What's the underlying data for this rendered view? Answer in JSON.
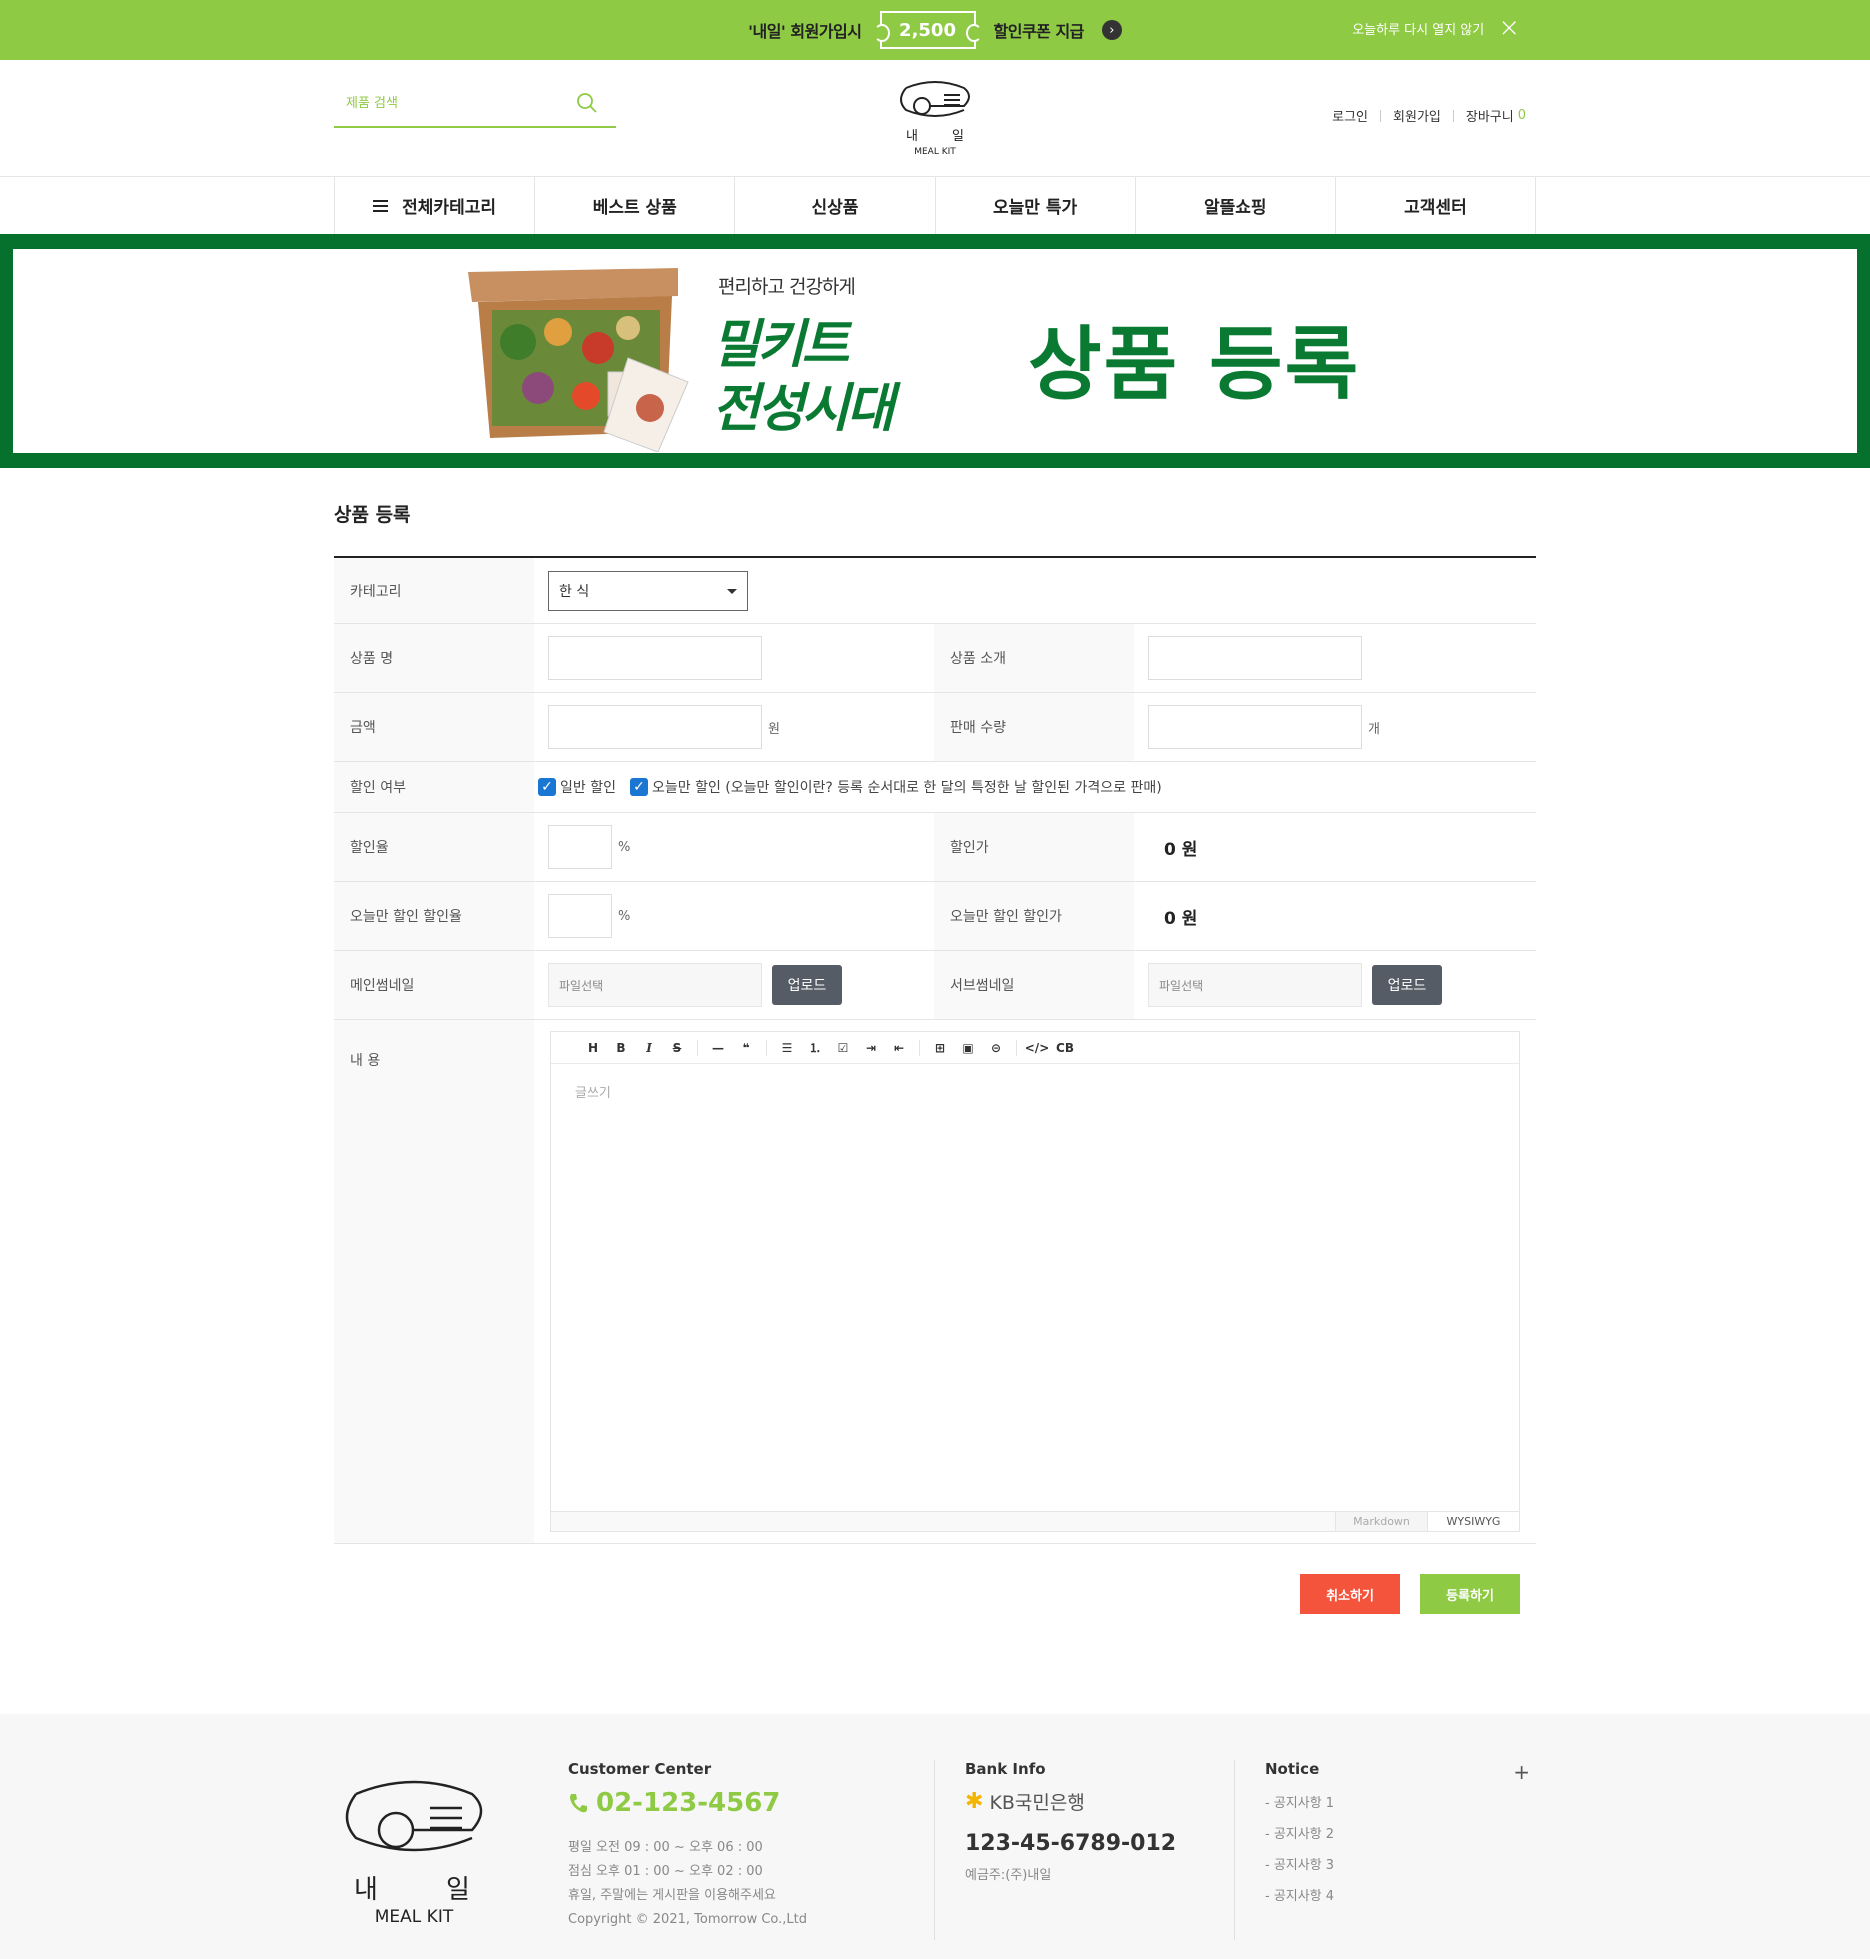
{
  "promo": {
    "text_left": "'내일' 회원가입시",
    "coupon_amount": "2,500",
    "text_right": "할인쿠폰 지급",
    "arrow": "›",
    "dismiss": "오늘하루 다시 열지 않기",
    "close": "×"
  },
  "header": {
    "search_placeholder": "제품 검색",
    "logo_name_left": "내",
    "logo_name_right": "일",
    "logo_sub": "MEAL KIT",
    "util": {
      "login": "로그인",
      "join": "회원가입",
      "cart": "장바구니",
      "cart_count": "0"
    }
  },
  "nav": [
    "전체카테고리",
    "베스트 상품",
    "신상품",
    "오늘만 특가",
    "알뜰쇼핑",
    "고객센터"
  ],
  "banner": {
    "sub": "편리하고 건강하게",
    "line1": "밀키트",
    "line2": "전성시대",
    "headline": "상품 등록"
  },
  "form": {
    "title": "상품 등록",
    "category_label": "카테고리",
    "category_value": "한 식",
    "name_label": "상품 명",
    "intro_label": "상품 소개",
    "price_label": "금액",
    "price_unit": "원",
    "stock_label": "판매 수량",
    "stock_unit": "개",
    "discount_label": "할인 여부",
    "discount_general": "일반 할인",
    "discount_today": "오늘만 할인 (오늘만 할인이란? 등록 순서대로 한 달의 특정한 날 할인된 가격으로 판매)",
    "rate_label": "할인율",
    "rate_unit": "%",
    "sale_price_label": "할인가",
    "sale_price_value": "0 원",
    "today_rate_label": "오늘만 할인 할인율",
    "today_rate_unit": "%",
    "today_price_label": "오늘만 할인 할인가",
    "today_price_value": "0 원",
    "main_thumb_label": "메인썸네일",
    "sub_thumb_label": "서브썸네일",
    "file_placeholder": "파일선택",
    "upload": "업로드",
    "content_label": "내 용",
    "editor_placeholder": "글쓰기",
    "editor_toolbar": [
      "H",
      "B",
      "I",
      "S",
      "—",
      "❝",
      "☰",
      "⒈",
      "☑",
      "⇥",
      "⇤",
      "⊞",
      "▣",
      "⊝",
      "</>",
      "CB"
    ],
    "mode_markdown": "Markdown",
    "mode_wysiwyg": "WYSIWYG",
    "cancel": "취소하기",
    "submit": "등록하기"
  },
  "footer": {
    "cs_title": "Customer Center",
    "phone": "02-123-4567",
    "hours1": "평일 오전 09 : 00 ~ 오후 06 : 00",
    "hours2": "점심 오후 01 : 00 ~ 오후 02 : 00",
    "hours3": "휴일, 주말에는 게시판을 이용해주세요",
    "copyright": "Copyright © 2021, Tomorrow Co.,Ltd",
    "bank_title": "Bank Info",
    "bank_name": "KB국민은행",
    "account": "123-45-6789-012",
    "holder": "예금주:(주)내일",
    "notice_title": "Notice",
    "notice_plus": "+",
    "notices": [
      "- 공지사항 1",
      "- 공지사항 2",
      "- 공지사항 3",
      "- 공지사항 4"
    ]
  },
  "colors": {
    "brand_green": "#8fca45",
    "banner_green": "#06702d",
    "cancel_red": "#f4543c",
    "upload_gray": "#555c65"
  }
}
